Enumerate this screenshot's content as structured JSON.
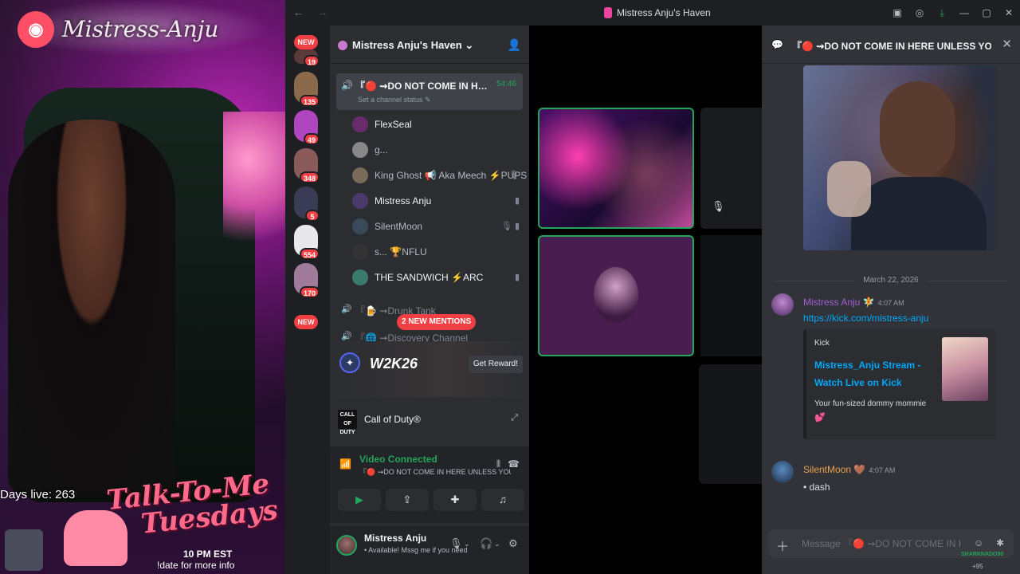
{
  "stream": {
    "brand": "Mistress-Anju",
    "days_live": "Days live: 263",
    "show_title_line1": "Talk-To-Me",
    "show_title_line2": "Tuesdays",
    "show_time": "10 PM EST",
    "show_info": "!date for more info"
  },
  "window": {
    "title": "Mistress Anju's Haven",
    "back": "←",
    "forward": "→"
  },
  "servers": {
    "new_top": "NEW",
    "new_bottom": "NEW",
    "badges": [
      "19",
      "135",
      "49",
      "348",
      "5",
      "554",
      "170"
    ]
  },
  "sidebar": {
    "server_name": "Mistress Anju's Haven ⌄",
    "active_channel": {
      "name": "『🔴 ⇝DO NOT COME IN HERE U...",
      "duration": "54:46",
      "status": "Set a channel status ✎"
    },
    "members": [
      {
        "name": "FlexSeal",
        "bright": true,
        "icon": ""
      },
      {
        "name": "g...",
        "bright": false,
        "icon": ""
      },
      {
        "name": "King Ghost 📢 Aka Meech ⚡PUPS",
        "bright": false,
        "icon": "🎙"
      },
      {
        "name": "Mistress Anju",
        "bright": true,
        "icon": "▮"
      },
      {
        "name": "SilentMoon",
        "bright": false,
        "icon": "🎙 ▮"
      },
      {
        "name": "s... 🏆NFLU",
        "bright": false,
        "icon": ""
      },
      {
        "name": "THE SANDWICH ⚡ARC",
        "bright": true,
        "icon": "▮"
      }
    ],
    "other_channels": [
      "『🍺 ⇝Drunk Tank",
      "『🌐 ⇝Discovery Channel"
    ],
    "mentions": "2 NEW MENTIONS",
    "promo": {
      "game": "W2K26",
      "reward_button": "Get Reward!"
    },
    "activity": {
      "game": "Call of Duty®",
      "icon_text": "CALL OF DUTY"
    },
    "voice": {
      "title": "Video Connected",
      "subtitle": "『🔴 ⇝DO NOT COME IN HERE UNLESS YOU'RE O..."
    },
    "user": {
      "name": "Mistress Anju",
      "status": "• Available! Mssg me if you need"
    }
  },
  "chat": {
    "header": "『🔴 ⇝DO NOT COME IN HERE UNLESS YOU'RE O|",
    "date_divider": "March 22, 2026",
    "messages": [
      {
        "author": "Mistress Anju 🧚",
        "time": "4:07 AM",
        "color": "#a05dd6",
        "link": "https://kick.com/mistress-anju",
        "embed": {
          "provider": "Kick",
          "title": "Mistress_Anju Stream - Watch Live on Kick",
          "description": "Your fun-sized dommy mommie",
          "emoji": "💕"
        }
      },
      {
        "author": "SilentMoon 🤎",
        "time": "4:07 AM",
        "color": "#e8a34e",
        "text": "• dash"
      }
    ],
    "composer_placeholder": "Message 『🔴 ⇝DO NOT COME IN HE...",
    "watermark": "SHARKNADO90",
    "watermark_sub": "+95"
  }
}
